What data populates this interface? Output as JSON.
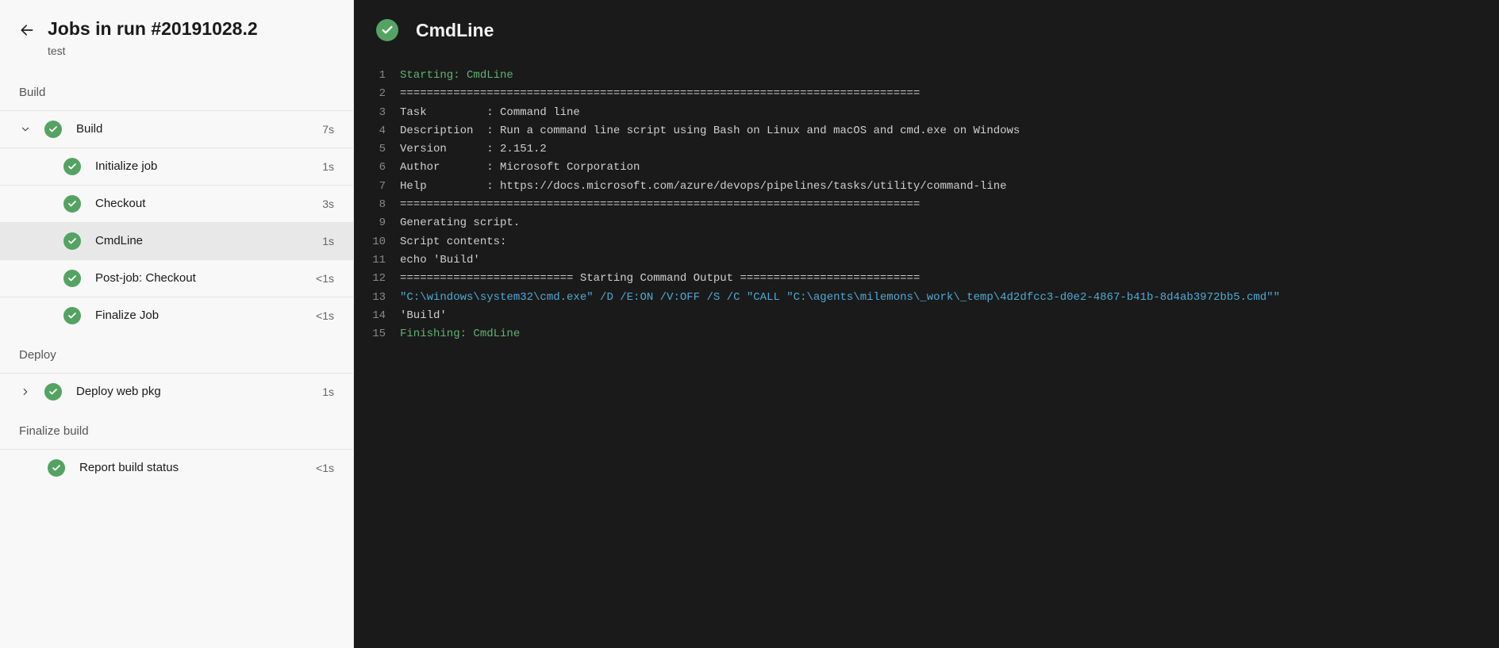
{
  "header": {
    "title": "Jobs in run #20191028.2",
    "subtitle": "test"
  },
  "stages": [
    {
      "name": "Build",
      "jobs": [
        {
          "label": "Build",
          "time": "7s",
          "expanded": true,
          "status": "success",
          "steps": [
            {
              "label": "Initialize job",
              "time": "1s",
              "status": "success",
              "selected": false
            },
            {
              "label": "Checkout",
              "time": "3s",
              "status": "success",
              "selected": false
            },
            {
              "label": "CmdLine",
              "time": "1s",
              "status": "success",
              "selected": true
            },
            {
              "label": "Post-job: Checkout",
              "time": "<1s",
              "status": "success",
              "selected": false
            },
            {
              "label": "Finalize Job",
              "time": "<1s",
              "status": "success",
              "selected": false
            }
          ]
        }
      ]
    },
    {
      "name": "Deploy",
      "jobs": [
        {
          "label": "Deploy web pkg",
          "time": "1s",
          "expanded": false,
          "status": "success",
          "steps": []
        }
      ]
    },
    {
      "name": "Finalize build",
      "jobs": [
        {
          "label": "Report build status",
          "time": "<1s",
          "expanded": null,
          "status": "success",
          "steps": []
        }
      ]
    }
  ],
  "log": {
    "title": "CmdLine",
    "status": "success",
    "lines": [
      {
        "n": 1,
        "cls": "c-green",
        "text": "Starting: CmdLine"
      },
      {
        "n": 2,
        "cls": "c-grey",
        "text": "=============================================================================="
      },
      {
        "n": 3,
        "cls": "c-grey",
        "text": "Task         : Command line"
      },
      {
        "n": 4,
        "cls": "c-grey",
        "text": "Description  : Run a command line script using Bash on Linux and macOS and cmd.exe on Windows"
      },
      {
        "n": 5,
        "cls": "c-grey",
        "text": "Version      : 2.151.2"
      },
      {
        "n": 6,
        "cls": "c-grey",
        "text": "Author       : Microsoft Corporation"
      },
      {
        "n": 7,
        "cls": "c-grey",
        "text": "Help         : https://docs.microsoft.com/azure/devops/pipelines/tasks/utility/command-line"
      },
      {
        "n": 8,
        "cls": "c-grey",
        "text": "=============================================================================="
      },
      {
        "n": 9,
        "cls": "c-grey",
        "text": "Generating script."
      },
      {
        "n": 10,
        "cls": "c-grey",
        "text": "Script contents:"
      },
      {
        "n": 11,
        "cls": "c-grey",
        "text": "echo 'Build'"
      },
      {
        "n": 12,
        "cls": "c-grey",
        "text": "========================== Starting Command Output ==========================="
      },
      {
        "n": 13,
        "cls": "c-blue",
        "text": "\"C:\\windows\\system32\\cmd.exe\" /D /E:ON /V:OFF /S /C \"CALL \"C:\\agents\\milemons\\_work\\_temp\\4d2dfcc3-d0e2-4867-b41b-8d4ab3972bb5.cmd\"\""
      },
      {
        "n": 14,
        "cls": "c-grey",
        "text": "'Build'"
      },
      {
        "n": 15,
        "cls": "c-green",
        "text": "Finishing: CmdLine"
      }
    ]
  }
}
